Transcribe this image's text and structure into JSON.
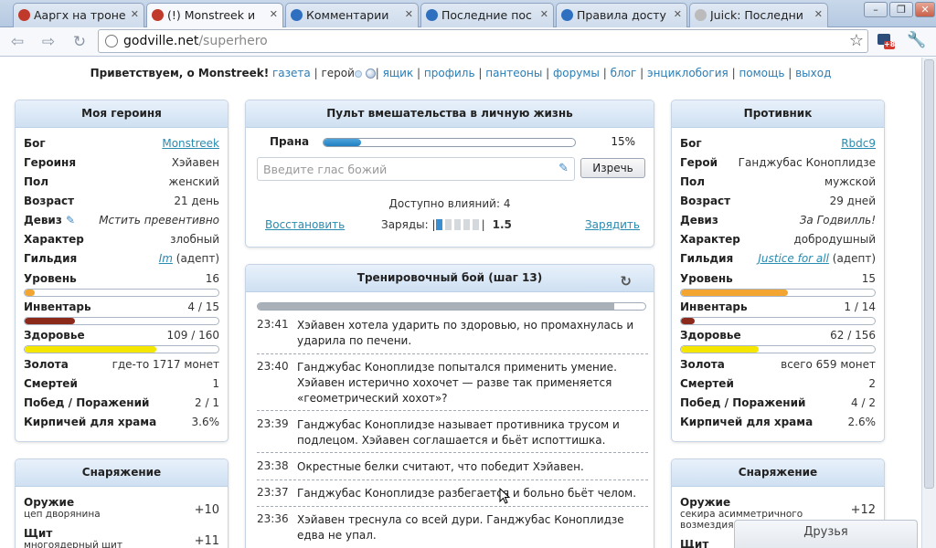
{
  "browser": {
    "tabs": [
      {
        "title": "Ааргх на троне",
        "icon_color": "#c0392b"
      },
      {
        "title": "(!) Monstreek и",
        "icon_color": "#c0392b"
      },
      {
        "title": "Комментарии",
        "icon_color": "#2f6fbf"
      },
      {
        "title": "Последние пос",
        "icon_color": "#2f6fbf"
      },
      {
        "title": "Правила досту",
        "icon_color": "#2f6fbf"
      },
      {
        "title": "Juick: Последни",
        "icon_color": "#bbbbbb"
      }
    ],
    "url_host": "godville.net",
    "url_path": "/superhero",
    "ext_badge": "+8"
  },
  "topnav": {
    "greeting": "Приветствуем, о Monstreek!",
    "gazette": "газета",
    "hero": "герой",
    "mailbox": "ящик",
    "profile": "профиль",
    "pantheons": "пантеоны",
    "forums": "форумы",
    "blog": "блог",
    "encyclopedia": "энциклобогия",
    "help": "помощь",
    "logout": "выход"
  },
  "hero": {
    "title": "Моя героиня",
    "rows": [
      {
        "k": "Бог",
        "v": "Monstreek",
        "link": true
      },
      {
        "k": "Героиня",
        "v": "Хэйавен"
      },
      {
        "k": "Пол",
        "v": "женский"
      },
      {
        "k": "Возраст",
        "v": "21 день"
      },
      {
        "k": "Девиз",
        "v": "Мстить превентивно"
      },
      {
        "k": "Характер",
        "v": "злобный"
      },
      {
        "k": "Гильдия",
        "v_link": "Im",
        "v_rest": " (адепт)"
      }
    ],
    "level": {
      "label": "Уровень",
      "value": "16",
      "fill": 0.05
    },
    "inventory": {
      "label": "Инвентарь",
      "value": "4 / 15",
      "fill": 0.26
    },
    "health": {
      "label": "Здоровье",
      "value": "109 / 160",
      "fill": 0.68
    },
    "stats": [
      {
        "k": "Золота",
        "v": "где-то 1717 монет"
      },
      {
        "k": "Смертей",
        "v": "1"
      },
      {
        "k": "Побед / Поражений",
        "v": "2 / 1"
      },
      {
        "k": "Кирпичей для храма",
        "v": "3.6%"
      }
    ]
  },
  "hero_equipment": {
    "title": "Снаряжение",
    "items": [
      {
        "slot": "Оружие",
        "name": "цеп дворянина",
        "bonus": "+10"
      },
      {
        "slot": "Щит",
        "name": "многоядерный щит",
        "bonus": "+11"
      }
    ]
  },
  "control": {
    "title": "Пульт вмешательства в личную жизнь",
    "prana_label": "Прана",
    "prana_value": "15%",
    "prana_fill": 0.15,
    "voice_placeholder": "Введите глас божий",
    "say_button": "Изречь",
    "influence": "Доступно влияний: 4",
    "restore": "Восстановить",
    "charges_label": "Заряды:",
    "charges_value": "1.5",
    "charges_filled": 1,
    "charges_total": 5,
    "recharge": "Зарядить"
  },
  "battle": {
    "title": "Тренировочный бой (шаг 13)",
    "progress": 0.92,
    "log": [
      {
        "time": "23:41",
        "msg": "Хэйавен хотела ударить по здоровью, но промахнулась и ударила по печени."
      },
      {
        "time": "23:40",
        "msg": "Ганджубас Коноплидзе попытался применить умение. Хэйавен истерично хохочет — разве так применяется «геометрический хохот»?"
      },
      {
        "time": "23:39",
        "msg": "Ганджубас Коноплидзе называет противника трусом и подлецом. Хэйавен соглашается и бьёт испоттишка."
      },
      {
        "time": "23:38",
        "msg": "Окрестные белки считают, что победит Хэйавен."
      },
      {
        "time": "23:37",
        "msg": "Ганджубас Коноплидзе разбегается и больно бьёт челом."
      },
      {
        "time": "23:36",
        "msg": "Хэйавен треснула со всей дури. Ганджубас Коноплидзе едва не упал."
      }
    ]
  },
  "enemy": {
    "title": "Противник",
    "rows": [
      {
        "k": "Бог",
        "v": "Rbdc9",
        "link": true
      },
      {
        "k": "Герой",
        "v": "Ганджубас Коноплидзе"
      },
      {
        "k": "Пол",
        "v": "мужской"
      },
      {
        "k": "Возраст",
        "v": "29 дней"
      },
      {
        "k": "Девиз",
        "v": "За Годвилль!"
      },
      {
        "k": "Характер",
        "v": "добродушный"
      },
      {
        "k": "Гильдия",
        "v_link": "Justice for all",
        "v_rest": " (адепт)"
      }
    ],
    "level": {
      "label": "Уровень",
      "value": "15",
      "fill": 0.55
    },
    "inventory": {
      "label": "Инвентарь",
      "value": "1 / 14",
      "fill": 0.07
    },
    "health": {
      "label": "Здоровье",
      "value": "62 / 156",
      "fill": 0.4
    },
    "stats": [
      {
        "k": "Золота",
        "v": "всего 659 монет"
      },
      {
        "k": "Смертей",
        "v": "2"
      },
      {
        "k": "Побед / Поражений",
        "v": "4 / 2"
      },
      {
        "k": "Кирпичей для храма",
        "v": "2.6%"
      }
    ]
  },
  "enemy_equipment": {
    "title": "Снаряжение",
    "items": [
      {
        "slot": "Оружие",
        "name": "секира асимметричного возмездия",
        "bonus": "+12"
      },
      {
        "slot": "Щит",
        "name": "",
        "bonus": ""
      }
    ]
  },
  "friends_label": "Друзья",
  "colors": {
    "level_hero": "#f2a531",
    "level_enemy": "#f2a531",
    "inventory": "#8b2a1a",
    "health": "#f5e600",
    "link": "#2a8bb0"
  }
}
